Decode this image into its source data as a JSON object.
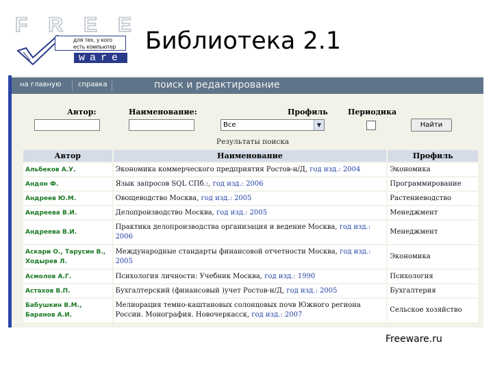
{
  "slide": {
    "title": "Библиотека 2.1",
    "footer": "Freeware.ru"
  },
  "logo": {
    "letters": "FREE",
    "tagline": "для тех, у кого есть компьютер",
    "ware": "ware"
  },
  "app": {
    "nav": [
      "на главную",
      "справка"
    ],
    "heading": "поиск и редактирование",
    "form": {
      "author_label": "Автор:",
      "name_label": "Наименование:",
      "profile_label": "Профиль",
      "periodical_label": "Периодика",
      "author_value": "",
      "name_value": "",
      "profile_value": "Все",
      "periodical_checked": false,
      "find_button": "Найти"
    },
    "results_caption": "Результаты поиска",
    "columns": [
      "Автор",
      "Наименование",
      "Профиль"
    ],
    "rows": [
      {
        "author": "Альбеков А.У.",
        "title": "Экономика коммерческого предприятия  Ростов-н/Д,",
        "year": "год изд.: 2004",
        "profile": "Экономика"
      },
      {
        "author": "Андон Ф.",
        "title": "Язык запросов SQL  СПб.:,",
        "year": "год изд.: 2006",
        "profile": "Программирование"
      },
      {
        "author": "Андреев Ю.М.",
        "title": "Овощеводство  Москва,",
        "year": "год изд.: 2005",
        "profile": "Растениеводство"
      },
      {
        "author": "Андреева В.И.",
        "title": "Делопроизводство  Москва,",
        "year": "год изд.: 2005",
        "profile": "Менеджмент"
      },
      {
        "author": "Андреева В.И.",
        "title": "Практика делопроизводства организация и ведение  Москва,",
        "year": "год изд.: 2006",
        "profile": "Менеджмент"
      },
      {
        "author": "Аскари О., Тарусин В., Ходырев Л.",
        "title": "Международные стандарты финансовой отчетности  Москва,",
        "year": "год изд.: 2005",
        "profile": "Экономика"
      },
      {
        "author": "Асмолов А.Г.",
        "title": "Психология личности: Учебник  Москва,",
        "year": "год изд.: 1990",
        "profile": "Психология"
      },
      {
        "author": "Астахов В.П.",
        "title": "Бухгалтерский (финансовый )учет  Ростов-н/Д,",
        "year": "год изд.: 2005",
        "profile": "Бухгалтерия"
      },
      {
        "author": "Бабушкин В.М., Баранов А.И.",
        "title": "Мелиорация темно-каштановых солонцовых почв Южного региона России. Монография.  Новочеркасск,",
        "year": "год изд.: 2007",
        "profile": "Сельское хозяйство"
      }
    ]
  }
}
